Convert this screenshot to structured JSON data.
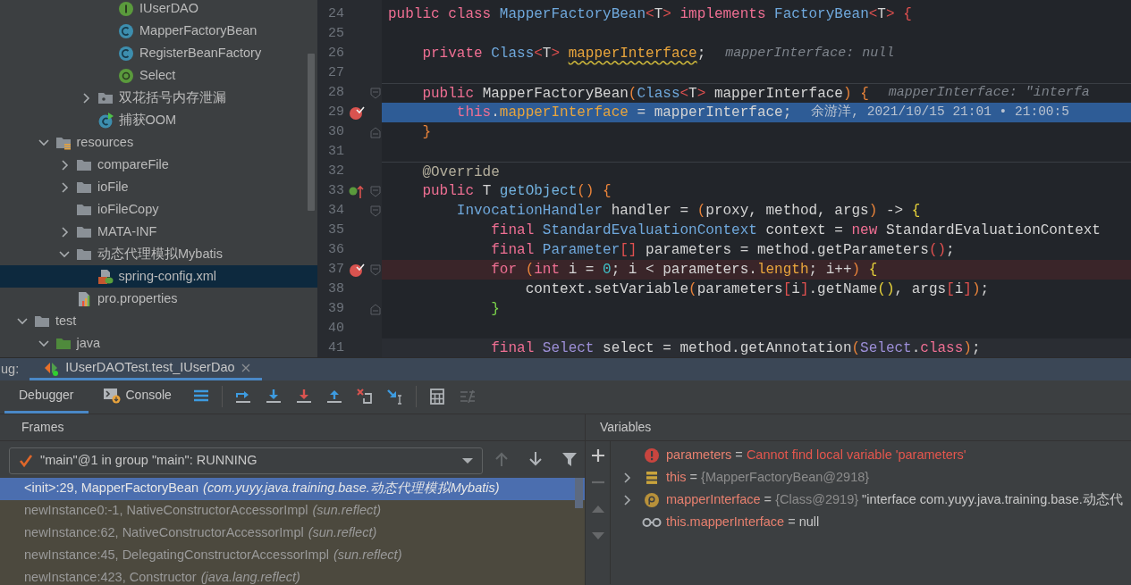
{
  "project_tree": {
    "items": [
      {
        "children": [
          {
            "children": [
              {
                "children": [
                  {
                    "children": [
                      {
                        "label": "IUserDAO",
                        "kind": "interface",
                        "selected": false
                      },
                      {
                        "label": "MapperFactoryBean",
                        "kind": "class",
                        "selected": false
                      },
                      {
                        "label": "RegisterBeanFactory",
                        "kind": "class",
                        "selected": false
                      },
                      {
                        "label": "Select",
                        "kind": "annotation",
                        "selected": false
                      }
                    ]
                  },
                  {
                    "label": "双花括号内存泄漏",
                    "kind": "package",
                    "expanded": false,
                    "selected": false
                  },
                  {
                    "label": "捕获OOM",
                    "kind": "class_main",
                    "selected": false
                  }
                ]
              }
            ]
          },
          {
            "label": "resources",
            "kind": "resources",
            "expanded": true,
            "selected": false,
            "children": [
              {
                "label": "compareFile",
                "kind": "folder",
                "expanded": false,
                "selected": false
              },
              {
                "label": "ioFile",
                "kind": "folder",
                "expanded": false,
                "selected": false
              },
              {
                "label": "ioFileCopy",
                "kind": "folder",
                "selected": false
              },
              {
                "label": "MATA-INF",
                "kind": "folder",
                "expanded": false,
                "selected": false
              },
              {
                "label": "动态代理模拟Mybatis",
                "kind": "folder",
                "expanded": true,
                "selected": false,
                "children": [
                  {
                    "label": "spring-config.xml",
                    "kind": "xml",
                    "selected": true
                  }
                ]
              },
              {
                "label": "pro.properties",
                "kind": "properties",
                "selected": false
              }
            ]
          }
        ]
      },
      {
        "label": "test",
        "kind": "folder",
        "expanded": true,
        "selected": false,
        "children": [
          {
            "label": "java",
            "kind": "source_folder",
            "expanded": true,
            "selected": false
          }
        ]
      }
    ]
  },
  "editor": {
    "lines": [
      {
        "number": "24",
        "kind": "plain",
        "separator": false,
        "breakpoint": false,
        "overrides": false,
        "fold_start": false,
        "fold_end": false,
        "tokens": [
          {
            "text": "public class ",
            "kind": "keyword"
          },
          {
            "text": "MapperFactoryBean",
            "kind": "type"
          },
          {
            "text": "<",
            "kind": "angle"
          },
          {
            "text": "T",
            "kind": "plain"
          },
          {
            "text": ">",
            "kind": "angle"
          },
          {
            "text": " implements ",
            "kind": "keyword"
          },
          {
            "text": "FactoryBean",
            "kind": "type"
          },
          {
            "text": "<",
            "kind": "angle"
          },
          {
            "text": "T",
            "kind": "plain"
          },
          {
            "text": "> {",
            "kind": "angle"
          }
        ]
      },
      {
        "number": "25",
        "kind": "plain",
        "separator": false,
        "breakpoint": false,
        "overrides": false,
        "fold_start": false,
        "fold_end": false
      },
      {
        "number": "26",
        "kind": "plain",
        "separator": false,
        "breakpoint": false,
        "overrides": false,
        "fold_start": false,
        "fold_end": false,
        "tokens": [
          {
            "text": "    private ",
            "kind": "keyword"
          },
          {
            "text": "Class",
            "kind": "type"
          },
          {
            "text": "<",
            "kind": "angle"
          },
          {
            "text": "T",
            "kind": "plain"
          },
          {
            "text": "> ",
            "kind": "angle"
          },
          {
            "text": "mapperInterface",
            "kind": "field_warning"
          },
          {
            "text": ";",
            "kind": "plain"
          }
        ],
        "hint": "mapperInterface: null"
      },
      {
        "number": "27",
        "kind": "plain",
        "separator": false,
        "breakpoint": false,
        "overrides": false,
        "fold_start": false,
        "fold_end": false
      },
      {
        "number": "28",
        "kind": "plain",
        "separator": true,
        "breakpoint": false,
        "overrides": false,
        "fold_start": true,
        "fold_end": false,
        "tokens": [
          {
            "text": "    public ",
            "kind": "keyword"
          },
          {
            "text": "MapperFactoryBean",
            "kind": "plain"
          },
          {
            "text": "(",
            "kind": "paren"
          },
          {
            "text": "Class",
            "kind": "type"
          },
          {
            "text": "<",
            "kind": "angle"
          },
          {
            "text": "T",
            "kind": "plain"
          },
          {
            "text": ">",
            "kind": "angle"
          },
          {
            "text": " mapperInterface",
            "kind": "plain"
          },
          {
            "text": ") {",
            "kind": "paren"
          }
        ],
        "hint": "mapperInterface: \"interfa"
      },
      {
        "number": "29",
        "kind": "execution",
        "separator": false,
        "breakpoint": true,
        "overrides": false,
        "fold_start": false,
        "fold_end": false,
        "tokens": [
          {
            "text": "        this",
            "kind": "keyword"
          },
          {
            "text": ".",
            "kind": "plain"
          },
          {
            "text": "mapperInterface",
            "kind": "field"
          },
          {
            "text": " = mapperInterface;",
            "kind": "plain"
          }
        ],
        "blame": "余游洋, 2021/10/15 21:01 • 21:00:5"
      },
      {
        "number": "30",
        "kind": "plain",
        "separator": false,
        "breakpoint": false,
        "overrides": false,
        "fold_start": false,
        "fold_end": true,
        "tokens": [
          {
            "text": "    }",
            "kind": "paren"
          }
        ]
      },
      {
        "number": "31",
        "kind": "plain",
        "separator": false,
        "breakpoint": false,
        "overrides": false,
        "fold_start": false,
        "fold_end": false
      },
      {
        "number": "32",
        "kind": "plain",
        "separator": true,
        "breakpoint": false,
        "overrides": false,
        "fold_start": false,
        "fold_end": false,
        "tokens": [
          {
            "text": "    @Override",
            "kind": "annotation"
          }
        ]
      },
      {
        "number": "33",
        "kind": "plain",
        "separator": false,
        "breakpoint": false,
        "overrides": true,
        "fold_start": true,
        "fold_end": false,
        "tokens": [
          {
            "text": "    public ",
            "kind": "keyword"
          },
          {
            "text": "T ",
            "kind": "plain"
          },
          {
            "text": "getObject",
            "kind": "method_decl"
          },
          {
            "text": "() {",
            "kind": "paren"
          }
        ]
      },
      {
        "number": "34",
        "kind": "plain",
        "separator": false,
        "breakpoint": false,
        "overrides": false,
        "fold_start": true,
        "fold_end": false,
        "tokens": [
          {
            "text": "        InvocationHandler",
            "kind": "type"
          },
          {
            "text": " handler = ",
            "kind": "plain"
          },
          {
            "text": "(",
            "kind": "paren"
          },
          {
            "text": "proxy, method, args",
            "kind": "plain"
          },
          {
            "text": ")",
            "kind": "paren"
          },
          {
            "text": " -> ",
            "kind": "plain"
          },
          {
            "text": "{",
            "kind": "yellow"
          }
        ]
      },
      {
        "number": "35",
        "kind": "plain",
        "separator": false,
        "breakpoint": false,
        "overrides": false,
        "fold_start": false,
        "fold_end": false,
        "tokens": [
          {
            "text": "            final ",
            "kind": "keyword"
          },
          {
            "text": "StandardEvaluationContext",
            "kind": "type"
          },
          {
            "text": " context = ",
            "kind": "plain"
          },
          {
            "text": "new ",
            "kind": "keyword"
          },
          {
            "text": "StandardEvaluationContext",
            "kind": "plain"
          }
        ]
      },
      {
        "number": "36",
        "kind": "plain",
        "separator": false,
        "breakpoint": false,
        "overrides": false,
        "fold_start": false,
        "fold_end": false,
        "tokens": [
          {
            "text": "            final ",
            "kind": "keyword"
          },
          {
            "text": "Parameter",
            "kind": "type"
          },
          {
            "text": "[]",
            "kind": "angle"
          },
          {
            "text": " parameters = method.getParameters",
            "kind": "plain"
          },
          {
            "text": "()",
            "kind": "angle"
          },
          {
            "text": ";",
            "kind": "plain"
          }
        ]
      },
      {
        "number": "37",
        "kind": "breakpoint",
        "separator": false,
        "breakpoint": true,
        "overrides": false,
        "fold_start": true,
        "fold_end": false,
        "tokens": [
          {
            "text": "            for ",
            "kind": "keyword"
          },
          {
            "text": "(",
            "kind": "paren"
          },
          {
            "text": "int ",
            "kind": "keyword"
          },
          {
            "text": "i = ",
            "kind": "plain"
          },
          {
            "text": "0",
            "kind": "number"
          },
          {
            "text": "; i < parameters.",
            "kind": "plain"
          },
          {
            "text": "length",
            "kind": "field"
          },
          {
            "text": "; i++",
            "kind": "plain"
          },
          {
            "text": ")",
            "kind": "paren"
          },
          {
            "text": " {",
            "kind": "yellow"
          }
        ]
      },
      {
        "number": "38",
        "kind": "plain",
        "separator": false,
        "breakpoint": false,
        "overrides": false,
        "fold_start": false,
        "fold_end": false,
        "tokens": [
          {
            "text": "                context.setVariable",
            "kind": "plain"
          },
          {
            "text": "(",
            "kind": "paren"
          },
          {
            "text": "parameters",
            "kind": "plain"
          },
          {
            "text": "[",
            "kind": "angle"
          },
          {
            "text": "i",
            "kind": "plain"
          },
          {
            "text": "]",
            "kind": "angle"
          },
          {
            "text": ".getName",
            "kind": "plain"
          },
          {
            "text": "()",
            "kind": "yellow"
          },
          {
            "text": ", args",
            "kind": "plain"
          },
          {
            "text": "[",
            "kind": "angle"
          },
          {
            "text": "i",
            "kind": "plain"
          },
          {
            "text": "]",
            "kind": "angle"
          },
          {
            "text": ")",
            "kind": "paren"
          },
          {
            "text": ";",
            "kind": "plain"
          }
        ]
      },
      {
        "number": "39",
        "kind": "plain",
        "separator": false,
        "breakpoint": false,
        "overrides": false,
        "fold_start": false,
        "fold_end": true,
        "tokens": [
          {
            "text": "            }",
            "kind": "green"
          }
        ]
      },
      {
        "number": "40",
        "kind": "plain",
        "separator": false,
        "breakpoint": false,
        "overrides": false,
        "fold_start": false,
        "fold_end": false
      },
      {
        "number": "41",
        "kind": "caret",
        "separator": false,
        "breakpoint": false,
        "overrides": false,
        "fold_start": false,
        "fold_end": false,
        "tokens": [
          {
            "text": "            final ",
            "kind": "keyword"
          },
          {
            "text": "Select",
            "kind": "annotation_type"
          },
          {
            "text": " select = method.getAnnotation",
            "kind": "plain"
          },
          {
            "text": "(",
            "kind": "paren"
          },
          {
            "text": "Select",
            "kind": "annotation_type"
          },
          {
            "text": ".",
            "kind": "plain"
          },
          {
            "text": "class",
            "kind": "keyword"
          },
          {
            "text": ")",
            "kind": "paren"
          },
          {
            "text": ";",
            "kind": "plain"
          }
        ]
      }
    ]
  },
  "debug": {
    "title": "ug:",
    "sessions": [
      {
        "label": "IUserDAOTest.test_IUserDao",
        "selected": true
      }
    ],
    "tabs": [
      {
        "label": "Debugger",
        "kind": "plain",
        "selected": true
      },
      {
        "label": "Console",
        "kind": "console",
        "selected": false
      }
    ],
    "toolbar": [
      {
        "kind": "layout",
        "disabled": false,
        "separator_before": false
      },
      {
        "kind": "step_over",
        "disabled": false,
        "separator_before": true
      },
      {
        "kind": "step_into",
        "disabled": false,
        "separator_before": false
      },
      {
        "kind": "force_step_into",
        "disabled": false,
        "separator_before": false
      },
      {
        "kind": "step_out",
        "disabled": false,
        "separator_before": false
      },
      {
        "kind": "drop_frame",
        "disabled": false,
        "separator_before": false
      },
      {
        "kind": "run_to_cursor",
        "disabled": false,
        "separator_before": false
      },
      {
        "kind": "evaluate",
        "disabled": false,
        "separator_before": true
      },
      {
        "kind": "trace",
        "disabled": true,
        "separator_before": false
      }
    ],
    "frames": {
      "title": "Frames",
      "thread": "\"main\"@1 in group \"main\": RUNNING",
      "tools": [
        {
          "kind": "up",
          "disabled": true
        },
        {
          "kind": "down",
          "disabled": false
        },
        {
          "kind": "filter",
          "disabled": false
        }
      ],
      "items": [
        {
          "location": "<init>:29, MapperFactoryBean",
          "package": "(com.yuyy.java.training.base.动态代理模拟Mybatis)",
          "selected": true,
          "library": false
        },
        {
          "location": "newInstance0:-1, NativeConstructorAccessorImpl",
          "package": "(sun.reflect)",
          "selected": false,
          "library": true
        },
        {
          "location": "newInstance:62, NativeConstructorAccessorImpl",
          "package": "(sun.reflect)",
          "selected": false,
          "library": true
        },
        {
          "location": "newInstance:45, DelegatingConstructorAccessorImpl",
          "package": "(sun.reflect)",
          "selected": false,
          "library": true
        },
        {
          "location": "newInstance:423, Constructor",
          "package": "(java.lang.reflect)",
          "selected": false,
          "library": true
        }
      ]
    },
    "variables": {
      "title": "Variables",
      "tools": [
        {
          "kind": "add",
          "disabled": false
        },
        {
          "kind": "remove",
          "disabled": true
        },
        {
          "kind": "move_up",
          "disabled": true
        },
        {
          "kind": "move_down",
          "disabled": true
        }
      ],
      "items": [
        {
          "kind": "error",
          "name": "parameters",
          "operator": "=",
          "value": "Cannot find local variable 'parameters'",
          "expandable": false
        },
        {
          "kind": "object",
          "name": "this",
          "operator": "=",
          "type": "{MapperFactoryBean@2918}",
          "expandable": true
        },
        {
          "kind": "parameter",
          "name": "mapperInterface",
          "operator": "=",
          "type": "{Class@2919}",
          "value": "\"interface com.yuyy.java.training.base.动态代",
          "expandable": true
        },
        {
          "kind": "watch",
          "name": "this.mapperInterface",
          "operator": "=",
          "value": "null",
          "expandable": false
        }
      ]
    }
  }
}
